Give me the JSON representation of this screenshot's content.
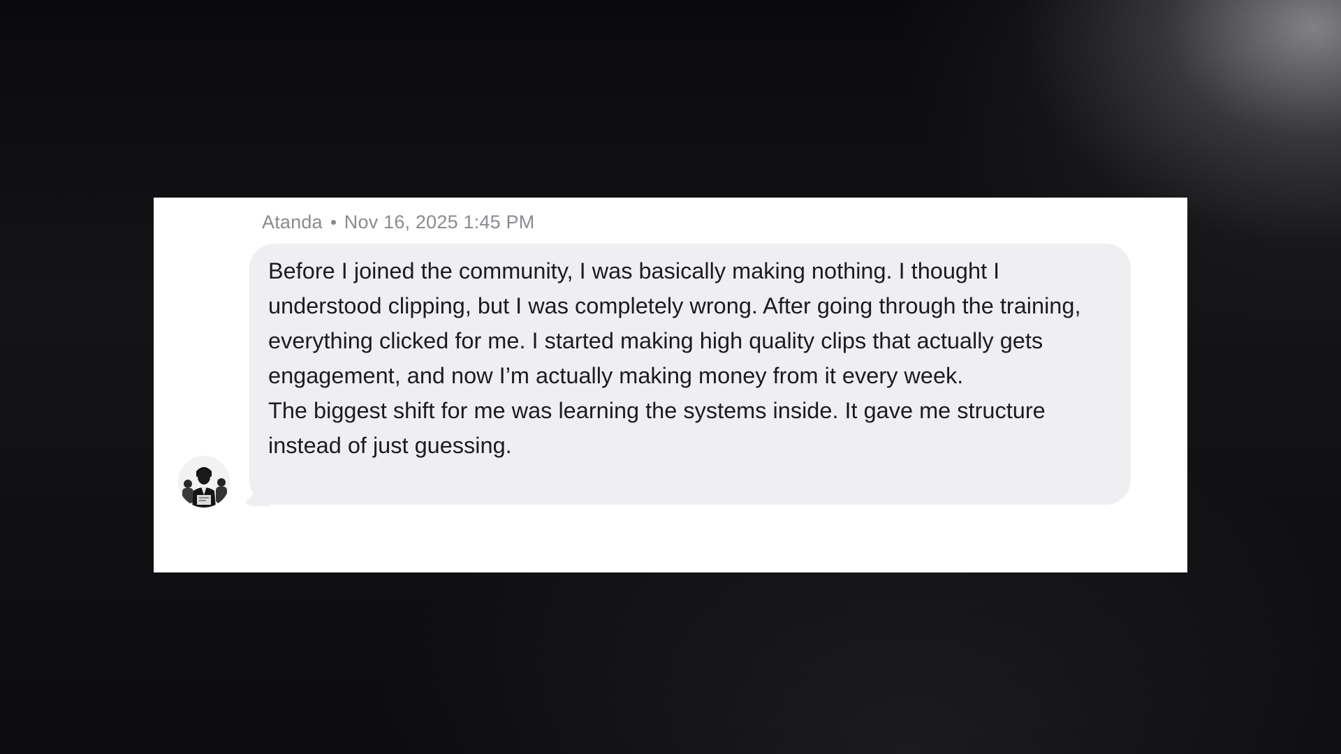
{
  "message": {
    "author": "Atanda",
    "timestamp": "Nov 16, 2025 1:45 PM",
    "paragraphs": [
      "Before I joined the community, I was basically making nothing. I thought I understood clipping, but I was completely wrong. After going through the training, everything clicked for me. I started making high quality clips that actually gets engagement, and now I’m actually making money from it every week.",
      "The biggest shift for me was learning the systems inside. It gave me structure instead of just guessing."
    ]
  },
  "colors": {
    "bubble": "#efeef1",
    "meta_text": "#8a8a90",
    "body_text": "#1c1c1f",
    "card": "#ffffff"
  }
}
